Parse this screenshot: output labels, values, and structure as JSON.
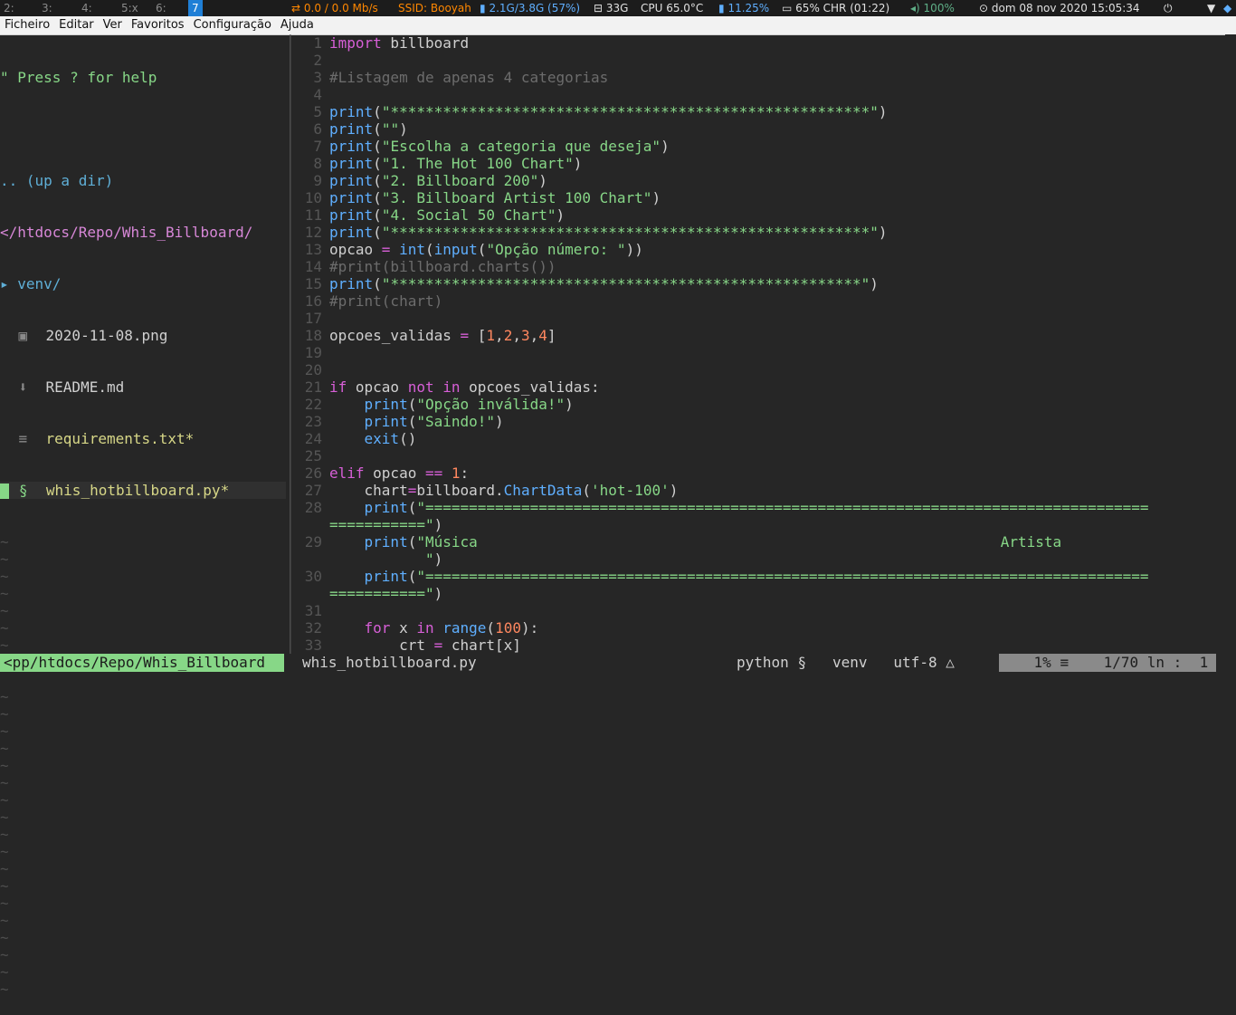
{
  "topbar": {
    "workspaces": [
      "2:",
      "3:",
      "4:",
      "5:x",
      "6:",
      "7"
    ],
    "active_workspace": "7",
    "net": "0.0 / 0.0 Mb/s",
    "ssid": "SSID: Booyah",
    "memory": "2.1G/3.8G (57%)",
    "disk": "33G",
    "cpu": "CPU 65.0°C",
    "cpu_usage": "11.25%",
    "battery": "65% CHR (01:22)",
    "volume": "100%",
    "clock": "dom 08 nov 2020 15:05:34"
  },
  "menubar": [
    "Ficheiro",
    "Editar",
    "Ver",
    "Favoritos",
    "Configuração",
    "Ajuda"
  ],
  "tree": {
    "help": "\" Press ? for help",
    "updir": ".. (up a dir)",
    "path": "</htdocs/Repo/Whis_Billboard/",
    "dir": "▸ venv/",
    "files": [
      {
        "name": "2020-11-08.png",
        "icon": "image-icon"
      },
      {
        "name": "README.md",
        "icon": "markdown-icon"
      },
      {
        "name": "requirements.txt*",
        "icon": "text-file-icon"
      },
      {
        "name": "whis_hotbillboard.py*",
        "icon": "python-icon"
      }
    ]
  },
  "line_numbers": [
    "1",
    "2",
    "3",
    "4",
    "5",
    "6",
    "7",
    "8",
    "9",
    "10",
    "11",
    "12",
    "13",
    "14",
    "15",
    "16",
    "17",
    "18",
    "19",
    "20",
    "21",
    "22",
    "23",
    "24",
    "25",
    "26",
    "27",
    "28",
    "",
    "29",
    "",
    "30",
    "",
    "31",
    "32",
    "33"
  ],
  "code": [
    [
      [
        "kw",
        "import"
      ],
      [
        "plain",
        " billboard"
      ]
    ],
    [],
    [
      [
        "cm",
        "#Listagem de apenas 4 categorias"
      ]
    ],
    [],
    [
      [
        "bi",
        "print"
      ],
      [
        "plain",
        "("
      ],
      [
        "str",
        "\"*******************************************************\""
      ],
      [
        "plain",
        ")"
      ]
    ],
    [
      [
        "bi",
        "print"
      ],
      [
        "plain",
        "("
      ],
      [
        "str",
        "\"\""
      ],
      [
        "plain",
        ")"
      ]
    ],
    [
      [
        "bi",
        "print"
      ],
      [
        "plain",
        "("
      ],
      [
        "str",
        "\"Escolha a categoria que deseja\""
      ],
      [
        "plain",
        ")"
      ]
    ],
    [
      [
        "bi",
        "print"
      ],
      [
        "plain",
        "("
      ],
      [
        "str",
        "\"1. The Hot 100 Chart\""
      ],
      [
        "plain",
        ")"
      ]
    ],
    [
      [
        "bi",
        "print"
      ],
      [
        "plain",
        "("
      ],
      [
        "str",
        "\"2. Billboard 200\""
      ],
      [
        "plain",
        ")"
      ]
    ],
    [
      [
        "bi",
        "print"
      ],
      [
        "plain",
        "("
      ],
      [
        "str",
        "\"3. Billboard Artist 100 Chart\""
      ],
      [
        "plain",
        ")"
      ]
    ],
    [
      [
        "bi",
        "print"
      ],
      [
        "plain",
        "("
      ],
      [
        "str",
        "\"4. Social 50 Chart\""
      ],
      [
        "plain",
        ")"
      ]
    ],
    [
      [
        "bi",
        "print"
      ],
      [
        "plain",
        "("
      ],
      [
        "str",
        "\"*******************************************************\""
      ],
      [
        "plain",
        ")"
      ]
    ],
    [
      [
        "plain",
        "opcao "
      ],
      [
        "op",
        "="
      ],
      [
        "plain",
        " "
      ],
      [
        "bi",
        "int"
      ],
      [
        "plain",
        "("
      ],
      [
        "bi",
        "input"
      ],
      [
        "plain",
        "("
      ],
      [
        "str",
        "\"Opção número: \""
      ],
      [
        "plain",
        "))"
      ]
    ],
    [
      [
        "cm",
        "#print(billboard.charts())"
      ]
    ],
    [
      [
        "bi",
        "print"
      ],
      [
        "plain",
        "("
      ],
      [
        "str",
        "\"******************************************************\""
      ],
      [
        "plain",
        ")"
      ]
    ],
    [
      [
        "cm",
        "#print(chart)"
      ]
    ],
    [],
    [
      [
        "plain",
        "opcoes_validas "
      ],
      [
        "op",
        "="
      ],
      [
        "plain",
        " ["
      ],
      [
        "num",
        "1"
      ],
      [
        "plain",
        ","
      ],
      [
        "num",
        "2"
      ],
      [
        "plain",
        ","
      ],
      [
        "num",
        "3"
      ],
      [
        "plain",
        ","
      ],
      [
        "num",
        "4"
      ],
      [
        "plain",
        "]"
      ]
    ],
    [],
    [],
    [
      [
        "kw",
        "if"
      ],
      [
        "plain",
        " opcao "
      ],
      [
        "kw",
        "not in"
      ],
      [
        "plain",
        " opcoes_validas:"
      ]
    ],
    [
      [
        "plain",
        "    "
      ],
      [
        "bi",
        "print"
      ],
      [
        "plain",
        "("
      ],
      [
        "str",
        "\"Opção inválida!\""
      ],
      [
        "plain",
        ")"
      ]
    ],
    [
      [
        "plain",
        "    "
      ],
      [
        "bi",
        "print"
      ],
      [
        "plain",
        "("
      ],
      [
        "str",
        "\"Saindo!\""
      ],
      [
        "plain",
        ")"
      ]
    ],
    [
      [
        "plain",
        "    "
      ],
      [
        "bi",
        "exit"
      ],
      [
        "plain",
        "()"
      ]
    ],
    [],
    [
      [
        "kw",
        "elif"
      ],
      [
        "plain",
        " opcao "
      ],
      [
        "op",
        "=="
      ],
      [
        "plain",
        " "
      ],
      [
        "num",
        "1"
      ],
      [
        "plain",
        ":"
      ]
    ],
    [
      [
        "plain",
        "    chart"
      ],
      [
        "op",
        "="
      ],
      [
        "plain",
        "billboard."
      ],
      [
        "bi",
        "ChartData"
      ],
      [
        "plain",
        "("
      ],
      [
        "str",
        "'hot-100'"
      ],
      [
        "plain",
        ")"
      ]
    ],
    [
      [
        "plain",
        "    "
      ],
      [
        "bi",
        "print"
      ],
      [
        "plain",
        "("
      ],
      [
        "str",
        "\"==================================================================================="
      ]
    ],
    [
      [
        "str",
        "===========\""
      ],
      [
        "plain",
        ")"
      ]
    ],
    [
      [
        "plain",
        "    "
      ],
      [
        "bi",
        "print"
      ],
      [
        "plain",
        "("
      ],
      [
        "str",
        "\"Música                                                            Artista"
      ]
    ],
    [
      [
        "str",
        "           \""
      ],
      [
        "plain",
        ")"
      ]
    ],
    [
      [
        "plain",
        "    "
      ],
      [
        "bi",
        "print"
      ],
      [
        "plain",
        "("
      ],
      [
        "str",
        "\"==================================================================================="
      ]
    ],
    [
      [
        "str",
        "===========\""
      ],
      [
        "plain",
        ")"
      ]
    ],
    [],
    [
      [
        "plain",
        "    "
      ],
      [
        "kw",
        "for"
      ],
      [
        "plain",
        " x "
      ],
      [
        "kw",
        "in"
      ],
      [
        "plain",
        " "
      ],
      [
        "bi",
        "range"
      ],
      [
        "plain",
        "("
      ],
      [
        "num",
        "100"
      ],
      [
        "plain",
        "):"
      ]
    ],
    [
      [
        "plain",
        "        crt "
      ],
      [
        "op",
        "="
      ],
      [
        "plain",
        " chart[x]"
      ]
    ]
  ],
  "statusline": {
    "left": "<pp/htdocs/Repo/Whis_Billboard",
    "file": "whis_hotbillboard.py",
    "filetype": "python",
    "venv": "venv",
    "encoding": "utf-8",
    "percent": "1%",
    "position": "1/70 ln :  1"
  }
}
